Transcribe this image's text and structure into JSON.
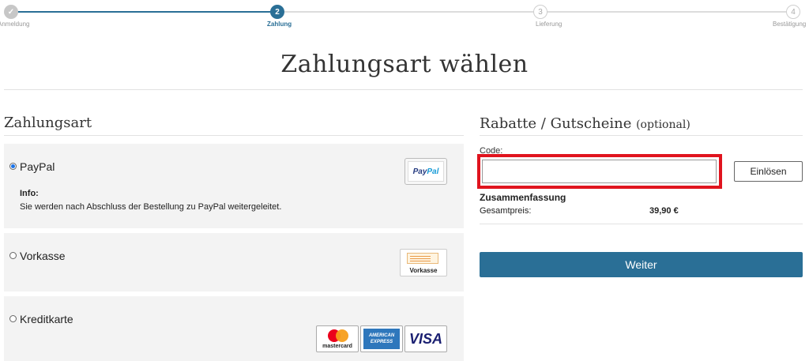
{
  "progress": {
    "steps": [
      {
        "number": "✓",
        "label": "Anmeldung",
        "state": "done"
      },
      {
        "number": "2",
        "label": "Zahlung",
        "state": "active"
      },
      {
        "number": "3",
        "label": "Lieferung",
        "state": "todo"
      },
      {
        "number": "4",
        "label": "Bestätigung",
        "state": "todo"
      }
    ],
    "colors": {
      "done": "#c7c7c7",
      "active": "#2a6f96",
      "todo_border": "#cfcfcf",
      "line_done": "#2a6f96",
      "line_todo": "#dcdcdc"
    }
  },
  "page": {
    "title": "Zahlungsart wählen"
  },
  "payment": {
    "heading": "Zahlungsart",
    "options": [
      {
        "label": "PayPal",
        "selected": true,
        "info_heading": "Info:",
        "info_text": "Sie werden nach Abschluss der Bestellung zu PayPal weitergeleitet.",
        "logo_text_1": "Pay",
        "logo_text_2": "Pal"
      },
      {
        "label": "Vorkasse",
        "selected": false,
        "logo_text": "Vorkasse"
      },
      {
        "label": "Kreditkarte",
        "selected": false,
        "cards": [
          {
            "name": "mastercard",
            "text": "mastercard"
          },
          {
            "name": "american-express",
            "text_1": "AMERICAN",
            "text_2": "EXPRESS"
          },
          {
            "name": "visa",
            "text": "VISA"
          }
        ]
      }
    ]
  },
  "discount": {
    "heading": "Rabatte / Gutscheine",
    "heading_optional": "(optional)",
    "code_label": "Code:",
    "code_value": "",
    "code_placeholder": "",
    "redeem_label": "Einlösen"
  },
  "summary": {
    "heading": "Zusammenfassung",
    "total_label": "Gesamtpreis:",
    "total_value": "39,90 €"
  },
  "actions": {
    "next_label": "Weiter"
  },
  "colors": {
    "accent": "#2a6f96",
    "highlight": "#e0141e",
    "panel": "#f3f3f3"
  }
}
